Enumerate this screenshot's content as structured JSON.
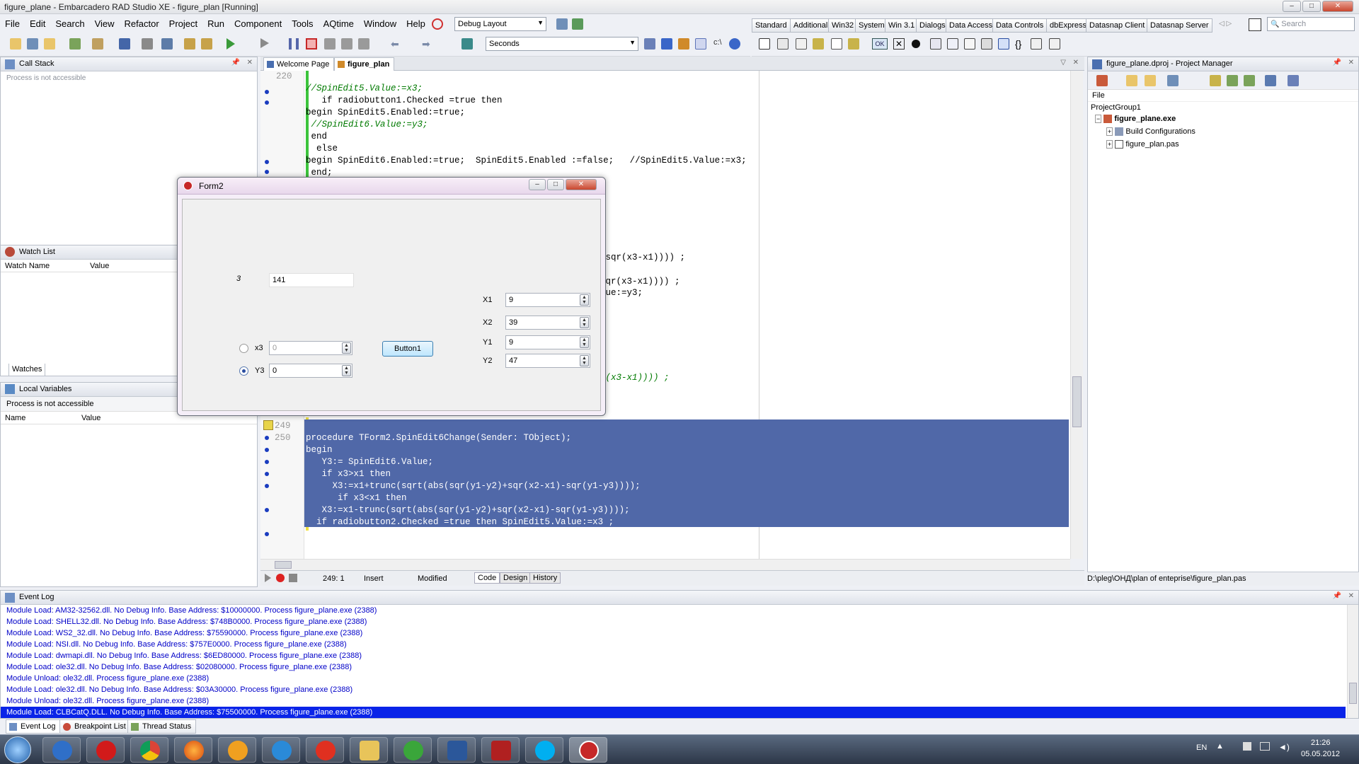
{
  "window": {
    "title": "figure_plane - Embarcadero RAD Studio XE - figure_plan [Running]"
  },
  "menu": [
    "File",
    "Edit",
    "Search",
    "View",
    "Refactor",
    "Project",
    "Run",
    "Component",
    "Tools",
    "AQtime",
    "Window",
    "Help"
  ],
  "toolbar": {
    "layout_combo": "Debug Layout",
    "seconds_combo": "Seconds",
    "search_placeholder": "Search"
  },
  "palette_tabs": [
    "Standard",
    "Additional",
    "Win32",
    "System",
    "Win 3.1",
    "Dialogs",
    "Data Access",
    "Data Controls",
    "dbExpress",
    "Datasnap Client",
    "Datasnap Server"
  ],
  "call_stack": {
    "title": "Call Stack",
    "message": "Process is not accessible"
  },
  "watch_list": {
    "title": "Watch List",
    "col_name": "Watch Name",
    "col_value": "Value",
    "tab": "Watches"
  },
  "local_vars": {
    "title": "Local Variables",
    "message": "Process is not accessible",
    "col_name": "Name",
    "col_value": "Value"
  },
  "editor": {
    "tabs": [
      "Welcome Page",
      "figure_plan"
    ],
    "top_lines": [
      {
        "num": "220",
        "text": "//SpinEdit5.Value:=x3;",
        "type": "comment"
      },
      {
        "num": "",
        "text": "   if radiobutton1.Checked =true then",
        "type": "code"
      },
      {
        "num": "",
        "text": "begin SpinEdit5.Enabled:=true;",
        "type": "code"
      },
      {
        "num": "",
        "text": " //SpinEdit6.Value:=y3;",
        "type": "comment"
      },
      {
        "num": "",
        "text": " end",
        "type": "code"
      },
      {
        "num": "",
        "text": "",
        "type": "code"
      },
      {
        "num": "",
        "text": "  else",
        "type": "code"
      },
      {
        "num": "",
        "text": "begin SpinEdit6.Enabled:=true;  SpinEdit5.Enabled :=false;   //SpinEdit5.Value:=x3;",
        "type": "code"
      },
      {
        "num": "",
        "text": " end;",
        "type": "code"
      }
    ],
    "mid_fragments": [
      "-sqr(x3-x1)))) ;",
      "sqr(x3-x1)))) ;",
      "lue:=y3;",
      "r(x3-x1)))) ;"
    ],
    "selected_lines": [
      {
        "num": "249",
        "text": "procedure TForm2.SpinEdit6Change(Sender: TObject);"
      },
      {
        "num": "250",
        "text": "begin"
      },
      {
        "num": "",
        "text": "   Y3:= SpinEdit6.Value;"
      },
      {
        "num": "",
        "text": "   if x3>x1 then"
      },
      {
        "num": "",
        "text": "     X3:=x1+trunc(sqrt(abs(sqr(y1-y2)+sqr(x2-x1)-sqr(y1-y3))));"
      },
      {
        "num": "",
        "text": "      if x3<x1 then"
      },
      {
        "num": "",
        "text": "   X3:=x1-trunc(sqrt(abs(sqr(y1-y2)+sqr(x2-x1)-sqr(y1-y3))));"
      },
      {
        "num": "",
        "text": "  if radiobutton2.Checked =true then SpinEdit5.Value:=x3 ;"
      },
      {
        "num": "",
        "text": ""
      },
      {
        "num": "",
        "text": "end;"
      }
    ],
    "status": {
      "position": "249:  1",
      "mode": "Insert",
      "modified": "Modified",
      "tabs": [
        "Code",
        "Design",
        "History"
      ]
    }
  },
  "project_manager": {
    "title": "figure_plane.dproj - Project Manager",
    "file_label": "File",
    "tree": [
      "ProjectGroup1",
      "figure_plane.exe",
      "Build Configurations",
      "figure_plan.pas"
    ],
    "path": "D:\\pleg\\ОНД\\plan of enteprise\\figure_plan.pas"
  },
  "form2": {
    "title": "Form2",
    "label_value": "3",
    "edit_value": "141",
    "radio_x3_label": "x3",
    "radio_y3_label": "Y3",
    "x3_value": "0",
    "y3_value": "0",
    "button_label": "Button1",
    "fields": [
      {
        "label": "X1",
        "value": "9"
      },
      {
        "label": "X2",
        "value": "39"
      },
      {
        "label": "Y1",
        "value": "9"
      },
      {
        "label": "Y2",
        "value": "47"
      }
    ]
  },
  "event_log": {
    "title": "Event Log",
    "lines": [
      "Module Load: AM32-32562.dll. No Debug Info. Base Address: $10000000. Process figure_plane.exe (2388)",
      "Module Load: SHELL32.dll. No Debug Info. Base Address: $748B0000. Process figure_plane.exe (2388)",
      "Module Load: WS2_32.dll. No Debug Info. Base Address: $75590000. Process figure_plane.exe (2388)",
      "Module Load: NSI.dll. No Debug Info. Base Address: $757E0000. Process figure_plane.exe (2388)",
      "Module Load: dwmapi.dll. No Debug Info. Base Address: $6ED80000. Process figure_plane.exe (2388)",
      "Module Load: ole32.dll. No Debug Info. Base Address: $02080000. Process figure_plane.exe (2388)",
      "Module Unload: ole32.dll. Process figure_plane.exe (2388)",
      "Module Load: ole32.dll. No Debug Info. Base Address: $03A30000. Process figure_plane.exe (2388)",
      "Module Unload: ole32.dll. Process figure_plane.exe (2388)"
    ],
    "selected_line": "Module Load: CLBCatQ.DLL. No Debug Info. Base Address: $75500000. Process figure_plane.exe (2388)"
  },
  "bottom_tabs": [
    "Event Log",
    "Breakpoint List",
    "Thread Status"
  ],
  "taskbar": {
    "lang": "EN",
    "time": "21:26",
    "date": "05.05.2012",
    "apps": [
      "outlook",
      "opera",
      "chrome",
      "firefox",
      "aimp",
      "internet-explorer",
      "yandex",
      "explorer",
      "utorrent",
      "word",
      "archive",
      "skype",
      "delphi"
    ]
  }
}
